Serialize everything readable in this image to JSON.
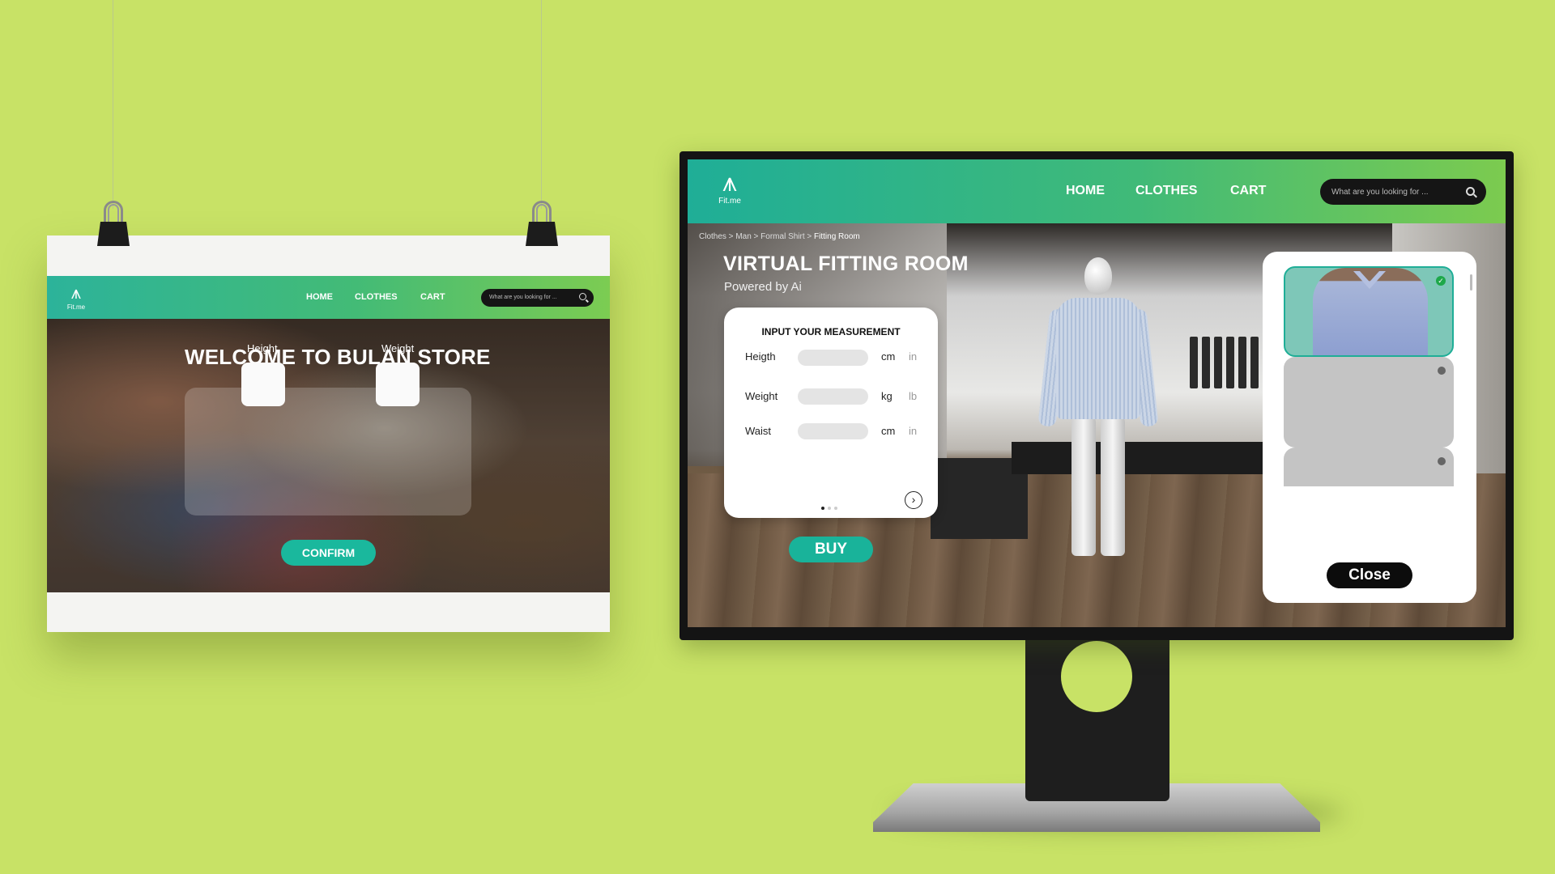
{
  "poster": {
    "logo_text": "Fit.me",
    "nav": [
      "HOME",
      "CLOTHES",
      "CART"
    ],
    "search_placeholder": "What are you looking for ...",
    "hero_title": "WELCOME TO BULAN STORE",
    "fields": [
      "Height",
      "Weight"
    ],
    "confirm_label": "CONFIRM"
  },
  "monitor": {
    "logo_text": "Fit.me",
    "nav": [
      "HOME",
      "CLOTHES",
      "CART"
    ],
    "search_placeholder": "What are you looking for ...",
    "breadcrumb": [
      "Clothes",
      "Man",
      "Formal Shirt",
      "Fitting Room"
    ],
    "title": "VIRTUAL FITTING ROOM",
    "subtitle": "Powered by Ai",
    "measurement": {
      "title": "INPUT YOUR MEASUREMENT",
      "rows": [
        {
          "label": "Heigth",
          "unit": "cm",
          "alt_unit": "in"
        },
        {
          "label": "Weight",
          "unit": "kg",
          "alt_unit": "lb"
        },
        {
          "label": "Waist",
          "unit": "cm",
          "alt_unit": "in"
        }
      ],
      "pages": 3,
      "current_page": 1
    },
    "buy_label": "BUY",
    "close_label": "Close"
  },
  "colors": {
    "background": "#c8e266",
    "nav_gradient_start": "#1fae97",
    "nav_gradient_end": "#7ccb4f",
    "accent": "#19b39a",
    "selected_check": "#1ea84a"
  }
}
